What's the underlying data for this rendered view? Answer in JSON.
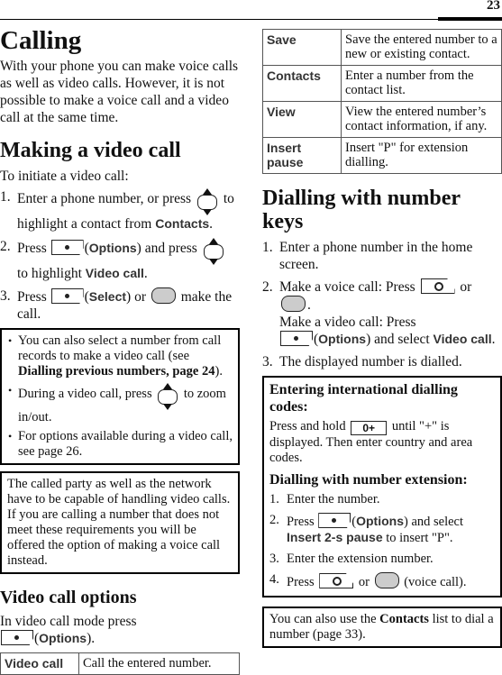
{
  "page_number": "23",
  "left": {
    "title": "Calling",
    "intro": "With your phone you can make voice calls as well as video calls. However, it is not possible to make a voice call and a video call at the same time.",
    "section1": {
      "heading": "Making a video call",
      "lead": "To initiate a video call:",
      "steps": [
        {
          "num": "1.",
          "a": "Enter a phone number, or press",
          "b": "to highlight a contact from",
          "c": "Contacts",
          "d": "."
        },
        {
          "num": "2.",
          "a": "Press",
          "b": "(",
          "c": "Options",
          "d": ") and press",
          "e": "to highlight",
          "f": "Video call",
          "g": "."
        },
        {
          "num": "3.",
          "a": "Press",
          "b": "(",
          "c": "Select",
          "d": ") or",
          "e": "make the call."
        }
      ]
    },
    "tips_box": {
      "items": [
        {
          "a": "You can also select a number from call records to make a video call (see ",
          "b": "Dialling previous numbers, page 24",
          "c": ")."
        },
        {
          "a": "During a video call, press",
          "b": "to zoom in/out."
        },
        {
          "a": "For options available during a video call, see page 26."
        }
      ]
    },
    "note_box": "The called party as well as the network have to be capable of handling video calls. If you are calling a number that does not meet these requirements you will be offered the option of making a voice call instead.",
    "section2": {
      "heading": "Video call options",
      "lead": "In video call mode press",
      "lead_open": "(",
      "lead_label": "Options",
      "lead_close": ")."
    },
    "options_table": [
      {
        "key": "Video call",
        "desc": "Call the entered number."
      }
    ]
  },
  "right": {
    "options_table": [
      {
        "key": "Save",
        "desc": "Save the entered number to a new or existing contact."
      },
      {
        "key": "Contacts",
        "desc": "Enter a number from the contact list."
      },
      {
        "key": "View",
        "desc": "View the entered number’s contact information, if any."
      },
      {
        "key": "Insert pause",
        "desc": "Insert \"P\" for extension dialling."
      }
    ],
    "section": {
      "heading": "Dialling with number keys",
      "steps": [
        {
          "num": "1.",
          "a": "Enter a phone number in the home screen."
        },
        {
          "num": "2.",
          "a": "Make a voice call: Press",
          "b": "or",
          "c": ".",
          "d": "Make a video call: Press",
          "e": "(",
          "f": "Options",
          "g": ") and select",
          "h": "Video call",
          "i": "."
        },
        {
          "num": "3.",
          "a": "The displayed number is dialled."
        }
      ]
    },
    "intl_box": {
      "heading1": "Entering international dialling codes:",
      "text1a": "Press and hold",
      "key_zero": "0+",
      "text1b": "until \"+\" is displayed. Then enter country and area codes.",
      "heading2": "Dialling with number extension:",
      "steps": [
        {
          "num": "1.",
          "a": "Enter the number."
        },
        {
          "num": "2.",
          "a": "Press",
          "b": "(",
          "c": "Options",
          "d": ") and select",
          "e": "Insert 2-s pause",
          "f": "to insert \"P\"."
        },
        {
          "num": "3.",
          "a": "Enter the extension number."
        },
        {
          "num": "4.",
          "a": "Press",
          "b": "or",
          "c": "(voice call)."
        }
      ]
    },
    "contacts_box": {
      "a": "You can also use the ",
      "b": "Contacts",
      "c": " list to dial a number (page 33)."
    }
  }
}
